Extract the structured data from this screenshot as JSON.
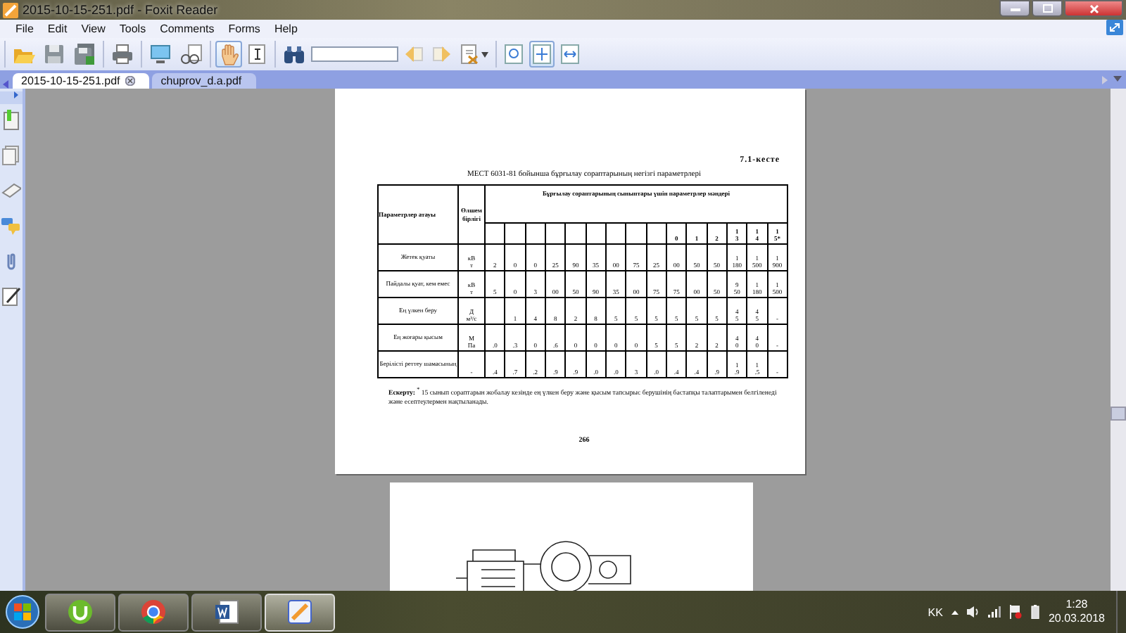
{
  "window": {
    "title": "2015-10-15-251.pdf - Foxit Reader"
  },
  "menu": [
    "File",
    "Edit",
    "View",
    "Tools",
    "Comments",
    "Forms",
    "Help"
  ],
  "toolbar": [
    [
      {
        "kind": "open",
        "selected": false
      },
      {
        "kind": "save",
        "selected": false
      },
      {
        "kind": "save-all",
        "selected": false
      }
    ],
    [
      {
        "kind": "print",
        "selected": false
      }
    ],
    [
      {
        "kind": "monitor",
        "selected": false
      },
      {
        "kind": "find-doc",
        "selected": false
      }
    ],
    [
      {
        "kind": "hand",
        "selected": true
      },
      {
        "kind": "select-text",
        "selected": false
      }
    ],
    [
      {
        "kind": "binoculars",
        "selected": false
      },
      {
        "kind": "field",
        "selected": false
      },
      {
        "kind": "prev",
        "selected": false
      },
      {
        "kind": "next",
        "selected": false
      },
      {
        "kind": "page-tool",
        "selected": false
      }
    ],
    [
      {
        "kind": "zoom",
        "selected": false
      },
      {
        "kind": "fit",
        "selected": true
      },
      {
        "kind": "width",
        "selected": false
      }
    ]
  ],
  "tabs": [
    {
      "label": "2015-10-15-251.pdf",
      "selected": true
    },
    {
      "label": "chuprov_d.a.pdf",
      "selected": false
    }
  ],
  "document": {
    "caption": "7.1-кесте",
    "title": "МЕСТ 6031-81 бойынша бұрғылау сораптарының негізгі параметрлері",
    "table": {
      "param_header": "Параметрлер атауы",
      "unit_header": "Өлшем бірлігі",
      "group_header": "Бұрғылау сораптарының сыныптары үшін параметрлер мәндері",
      "class_numbers": [
        "0",
        "1",
        "2",
        "1\n3",
        "1\n4",
        "1\n5*"
      ],
      "rows": [
        {
          "name": "Жетек қуаты",
          "unit": "кВ\nт",
          "values": [
            "2",
            "0",
            "0",
            "25",
            "90",
            "35",
            "00",
            "75",
            "25",
            "00",
            "50",
            "50",
            "1\n180",
            "1\n500",
            "1\n900"
          ]
        },
        {
          "name": "Пайдалы қуат, кем емес",
          "unit": "кВ\nт",
          "values": [
            "5",
            "0",
            "3",
            "00",
            "50",
            "90",
            "35",
            "00",
            "75",
            "75",
            "00",
            "50",
            "9\n50",
            "1\n180",
            "1\n500"
          ]
        },
        {
          "name": "Ең үлкен беру",
          "unit": "Д\nм³/с",
          "values": [
            "1",
            "4",
            "8",
            "2",
            "8",
            "5",
            "5",
            "5",
            "5",
            "5",
            "5",
            "4\n5",
            "4\n5",
            "-"
          ]
        },
        {
          "name": "Ең жоғары қысым",
          "unit": "М\nПа",
          "values": [
            ".0",
            ".3",
            "0",
            ".6",
            "0",
            "0",
            "0",
            "0",
            "5",
            "5",
            "2",
            "2",
            "4\n0",
            "4\n0",
            "-"
          ]
        },
        {
          "name": "Берілісті реттеу шамасының",
          "unit": "-",
          "values": [
            ".4",
            ".7",
            ".2",
            ".9",
            ".9",
            ".0",
            ".0",
            "3",
            ".0",
            ".4",
            ".4",
            ".9",
            "1\n.9",
            "1\n.5",
            "-"
          ]
        }
      ]
    },
    "note": "**Ескерту:** $^{*}$ 15 сынып сораптарын жобалау кезінде ең үлкен беру және қысым тапсырыс берушінің бастапқы талаптарымен белгіленеді және есептеулермен нақтыланады.",
    "page_number": "266"
  },
  "taskbar": {
    "apps": [
      {
        "kind": "torrent",
        "selected": false
      },
      {
        "kind": "chrome",
        "selected": false
      },
      {
        "kind": "word",
        "selected": false
      },
      {
        "kind": "reader",
        "selected": true
      }
    ],
    "language": "KK",
    "time": "1:28",
    "date": "20.03.2018"
  }
}
